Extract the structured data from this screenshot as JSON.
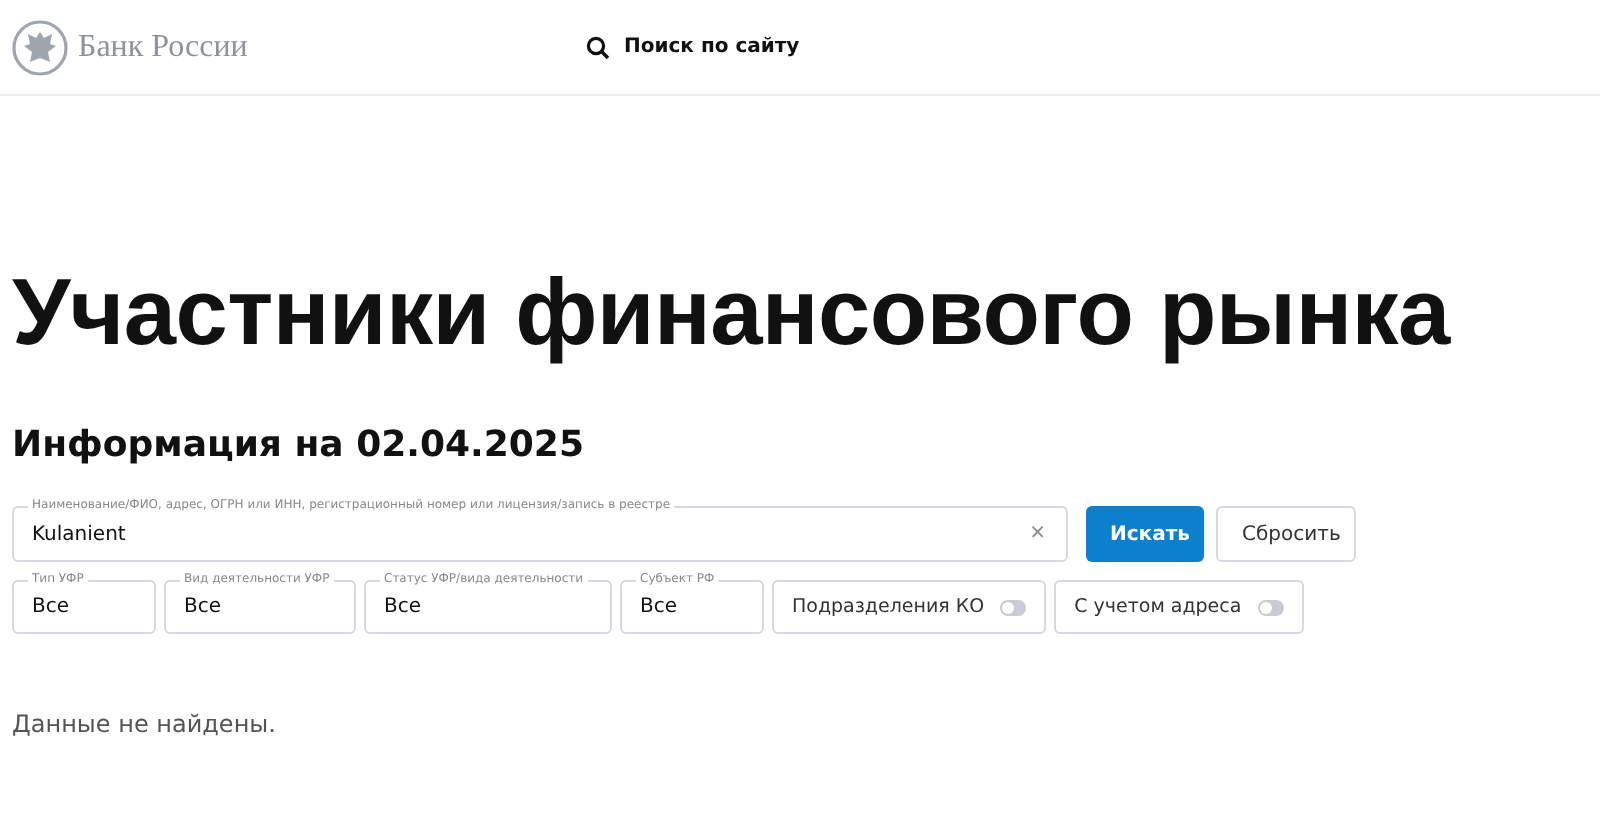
{
  "header": {
    "logo_text": "Банк России",
    "search_link": "Поиск по сайту"
  },
  "title": "Участники финансового рынка",
  "subtitle": "Информация на 02.04.2025",
  "search": {
    "label": "Наименование/ФИО, адрес, ОГРН или ИНН, регистрационный номер или лицензия/запись в реестре",
    "value": "Kulanient",
    "clear": "×"
  },
  "buttons": [
    {
      "label": "Искать",
      "kind": "primary"
    },
    {
      "label": "Сбросить",
      "kind": "secondary"
    }
  ],
  "filters": [
    {
      "label": "Тип УФР",
      "value": "Все"
    },
    {
      "label": "Вид деятельности УФР",
      "value": "Все"
    },
    {
      "label": "Статус УФР/вида деятельности",
      "value": "Все"
    },
    {
      "label": "Субъект РФ",
      "value": "Все"
    }
  ],
  "toggles": [
    {
      "label": "Подразделения КО",
      "on": false
    },
    {
      "label": "С учетом адреса",
      "on": false
    }
  ],
  "message": "Данные не найдены."
}
